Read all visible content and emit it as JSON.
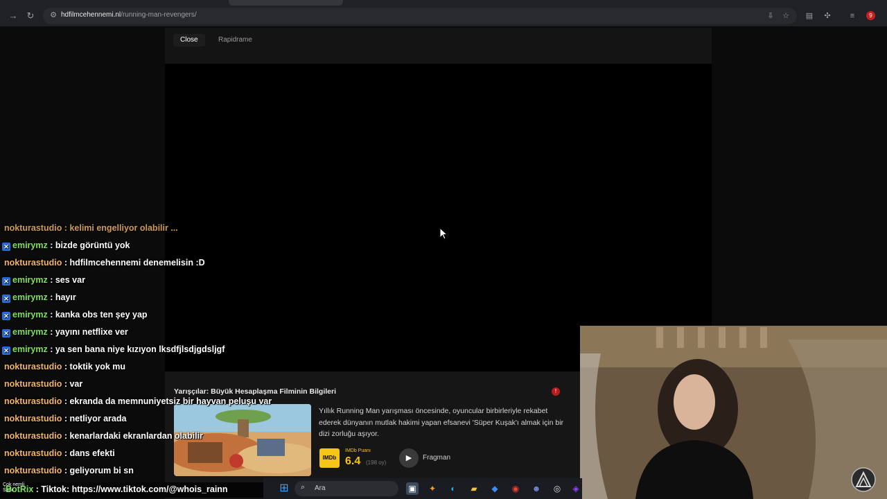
{
  "browser": {
    "url_domain": "hdfilmcehennemi.nl",
    "url_path": "/running-man-revengers/",
    "profile_initial": "9"
  },
  "player": {
    "close_label": "Close",
    "source_label": "Rapidrame"
  },
  "movie": {
    "title": "Yarışçılar: Büyük Hesaplaşma Filminin Bilgileri",
    "description": "Yıllık Running Man yarışması öncesinde, oyuncular birbirleriyle rekabet ederek dünyanın mutlak hakimi yapan efsanevi 'Süper Kuşak'ı almak için bir dizi zorluğu aşıyor.",
    "imdb_logo": "IMDb",
    "imdb_caption": "IMDb Puanı",
    "imdb_score": "6.4",
    "imdb_votes": "(198 oy)",
    "trailer_label": "Fragman"
  },
  "chat": {
    "cut_line": "nokturastudio : kelimi engelliyor olabilir ...",
    "messages": [
      {
        "user": "emirymz",
        "sep": " : ",
        "text": "bizde görüntü yok"
      },
      {
        "user": "nokturastudio",
        "sep": " : ",
        "text": "hdfilmcehennemi denemelisin :D"
      },
      {
        "user": "emirymz",
        "sep": " : ",
        "text": "ses var"
      },
      {
        "user": "emirymz",
        "sep": " : ",
        "text": "hayır"
      },
      {
        "user": "emirymz",
        "sep": " : ",
        "text": "kanka obs ten şey yap"
      },
      {
        "user": "emirymz",
        "sep": " : ",
        "text": "yayını netflixe ver"
      },
      {
        "user": "emirymz",
        "sep": " : ",
        "text": "ya sen bana niye kızıyon lksdfjlsdjgdsljgf"
      },
      {
        "user": "nokturastudio",
        "sep": " : ",
        "text": "toktik yok mu"
      },
      {
        "user": "nokturastudio",
        "sep": " : ",
        "text": "var"
      },
      {
        "user": "nokturastudio",
        "sep": " : ",
        "text": "ekranda da memnuniyetsiz bir hayvan peluşu var"
      },
      {
        "user": "nokturastudio",
        "sep": " : ",
        "text": "netliyor arada"
      },
      {
        "user": "nokturastudio",
        "sep": " : ",
        "text": "kenarlardaki ekranlardan olabilir"
      },
      {
        "user": "nokturastudio",
        "sep": " : ",
        "text": "dans efekti"
      },
      {
        "user": "nokturastudio",
        "sep": " : ",
        "text": "geliyorum bi sn"
      }
    ]
  },
  "ticker": {
    "tag_line1": "Çok nemli",
    "tag_line2": "Sadi",
    "bot": "BotRix",
    "text": ": Tiktok: https://www.tiktok.com/@whois_rainn"
  },
  "taskbar": {
    "search_placeholder": "Ara"
  },
  "colors": {
    "chat_user_subscriber": "#7ee35a",
    "chat_user_regular": "#f2b561",
    "imdb_yellow": "#f5c518"
  }
}
